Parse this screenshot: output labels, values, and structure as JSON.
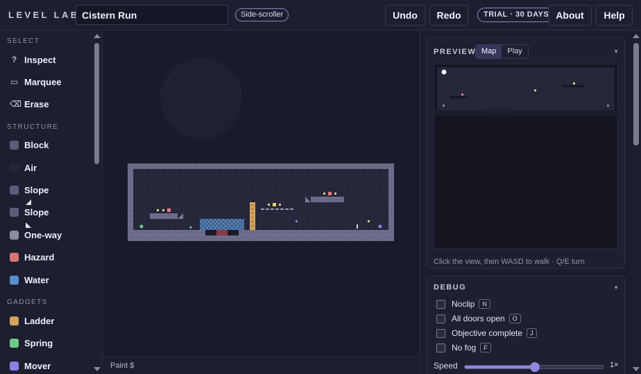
{
  "app": {
    "brand": "LEVEL LAB",
    "level_name": "Cistern Run",
    "mode": "Side-scroller"
  },
  "toolbar": {
    "undo": "Undo",
    "redo": "Redo",
    "trial": "TRIAL · 30 DAYS",
    "about": "About",
    "help": "Help"
  },
  "sidebar": {
    "sections": {
      "select": "SELECT",
      "structure": "STRUCTURE",
      "gadgets": "GADGETS"
    },
    "select_items": [
      {
        "label": "Inspect",
        "icon": "question-icon",
        "glyph": "?"
      },
      {
        "label": "Marquee",
        "icon": "marquee-icon",
        "glyph": "▭"
      },
      {
        "label": "Erase",
        "icon": "erase-icon",
        "glyph": "⌫"
      }
    ],
    "structure_items": [
      {
        "label": "Block",
        "color": "#5c5c7a"
      },
      {
        "label": "Air",
        "color": "#252638"
      },
      {
        "label": "Slope",
        "color": "#5c5c7a"
      },
      {
        "label": "Slope",
        "color": "#5c5c7a"
      },
      {
        "label": "One-way",
        "color": "#8a8aa0"
      },
      {
        "label": "Hazard",
        "color": "#d97474"
      },
      {
        "label": "Water",
        "color": "#5a8ed0"
      }
    ],
    "gadget_items": [
      {
        "label": "Ladder",
        "color": "#d3a25c"
      },
      {
        "label": "Spring",
        "color": "#6fcc8a"
      },
      {
        "label": "Mover",
        "color": "#8a82e0"
      }
    ]
  },
  "status_bar": {
    "text": "Paint $"
  },
  "preview": {
    "title": "PREVIEW",
    "tabs": [
      "Map",
      "Play"
    ],
    "active_tab": "Map",
    "hint": "Click the view, then WASD to walk · Q/E turn"
  },
  "debug": {
    "title": "DEBUG",
    "options": [
      {
        "label": "Noclip",
        "key": "N",
        "checked": false
      },
      {
        "label": "All doors open",
        "key": "O",
        "checked": false
      },
      {
        "label": "Objective complete",
        "key": "J",
        "checked": false
      },
      {
        "label": "No fog",
        "key": "F",
        "checked": false
      }
    ],
    "speed_label": "Speed",
    "speed_value": "1×",
    "speed_fraction": 0.5
  },
  "colors": {
    "accent": "#8f86e0",
    "background": "#1b1c2c"
  }
}
